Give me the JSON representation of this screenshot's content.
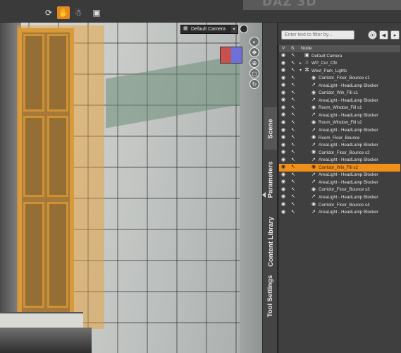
{
  "app": {
    "logo_text": "DAZ 3D"
  },
  "toolbar": {
    "icons": [
      "rotate-tool-icon",
      "hand-tool-icon",
      "figure-tool-icon",
      "camera-tool-icon"
    ],
    "active_index": 1
  },
  "viewport": {
    "camera_label": "Default Camera",
    "dropdown_arrow": "▾",
    "nav_tools": [
      "view-toggle-icon",
      "orbit-icon",
      "pan-icon",
      "zoom-icon",
      "frame-icon",
      "dolly-icon",
      "reset-icon"
    ]
  },
  "side_tabs": {
    "scene": "Scene",
    "parameters": "Parameters",
    "content_library": "Content Library",
    "tool_settings": "Tool Settings",
    "active": "scene"
  },
  "scene_panel": {
    "filter_placeholder": "Enter text to filter by...",
    "columns": {
      "visible": "V",
      "selectable": "S",
      "node": "Node"
    },
    "rows": [
      {
        "label": "Default Camera",
        "icon": "camera-icon",
        "depth": 0,
        "expander": "",
        "selected": false
      },
      {
        "label": "WP_Cor_Cflr",
        "icon": "figure-icon",
        "depth": 0,
        "expander": "▸",
        "selected": false
      },
      {
        "label": "West_Park_Lights",
        "icon": "group-icon",
        "depth": 0,
        "expander": "▾",
        "selected": false
      },
      {
        "label": "Corridor_Floor_Bounce s1",
        "icon": "light-icon",
        "depth": 1,
        "expander": "",
        "selected": false
      },
      {
        "label": "AreaLight - HeadLamp Blocker",
        "icon": "arealight-icon",
        "depth": 1,
        "expander": "",
        "selected": false
      },
      {
        "label": "Corridor_Win_Fill s1",
        "icon": "light-icon",
        "depth": 1,
        "expander": "",
        "selected": false
      },
      {
        "label": "AreaLight - HeadLamp Blocker",
        "icon": "arealight-icon",
        "depth": 1,
        "expander": "",
        "selected": false
      },
      {
        "label": "Room_Window_Fill s1",
        "icon": "light-icon",
        "depth": 1,
        "expander": "",
        "selected": false
      },
      {
        "label": "AreaLight - HeadLamp Blocker",
        "icon": "arealight-icon",
        "depth": 1,
        "expander": "",
        "selected": false
      },
      {
        "label": "Room_Window_Fill s2",
        "icon": "light-icon",
        "depth": 1,
        "expander": "",
        "selected": false
      },
      {
        "label": "AreaLight - HeadLamp Blocker",
        "icon": "arealight-icon",
        "depth": 1,
        "expander": "",
        "selected": false
      },
      {
        "label": "Room_Floor_Bounce",
        "icon": "light-icon",
        "depth": 1,
        "expander": "",
        "selected": false
      },
      {
        "label": "AreaLight - HeadLamp Blocker",
        "icon": "arealight-icon",
        "depth": 1,
        "expander": "",
        "selected": false
      },
      {
        "label": "Corridor_Floor_Bounce s2",
        "icon": "light-icon",
        "depth": 1,
        "expander": "",
        "selected": false
      },
      {
        "label": "AreaLight - HeadLamp Blocker",
        "icon": "arealight-icon",
        "depth": 1,
        "expander": "",
        "selected": false
      },
      {
        "label": "Corridor_Win_Fill s2",
        "icon": "light-icon",
        "depth": 1,
        "expander": "",
        "selected": true
      },
      {
        "label": "AreaLight - HeadLamp Blocker",
        "icon": "arealight-icon",
        "depth": 1,
        "expander": "",
        "selected": false
      },
      {
        "label": "AreaLight - HeadLamp Blocker",
        "icon": "arealight-icon",
        "depth": 1,
        "expander": "",
        "selected": false
      },
      {
        "label": "Corridor_Floor_Bounce s3",
        "icon": "light-icon",
        "depth": 1,
        "expander": "",
        "selected": false
      },
      {
        "label": "AreaLight - HeadLamp Blocker",
        "icon": "arealight-icon",
        "depth": 1,
        "expander": "",
        "selected": false
      },
      {
        "label": "Corridor_Floor_Bounce s4",
        "icon": "light-icon",
        "depth": 1,
        "expander": "",
        "selected": false
      },
      {
        "label": "AreaLight - HeadLamp Blocker",
        "icon": "arealight-icon",
        "depth": 1,
        "expander": "",
        "selected": false
      }
    ]
  },
  "colors": {
    "accent": "#f09018",
    "panel_bg": "#3d3d3d",
    "viewport_selection": "#eb9b28"
  }
}
